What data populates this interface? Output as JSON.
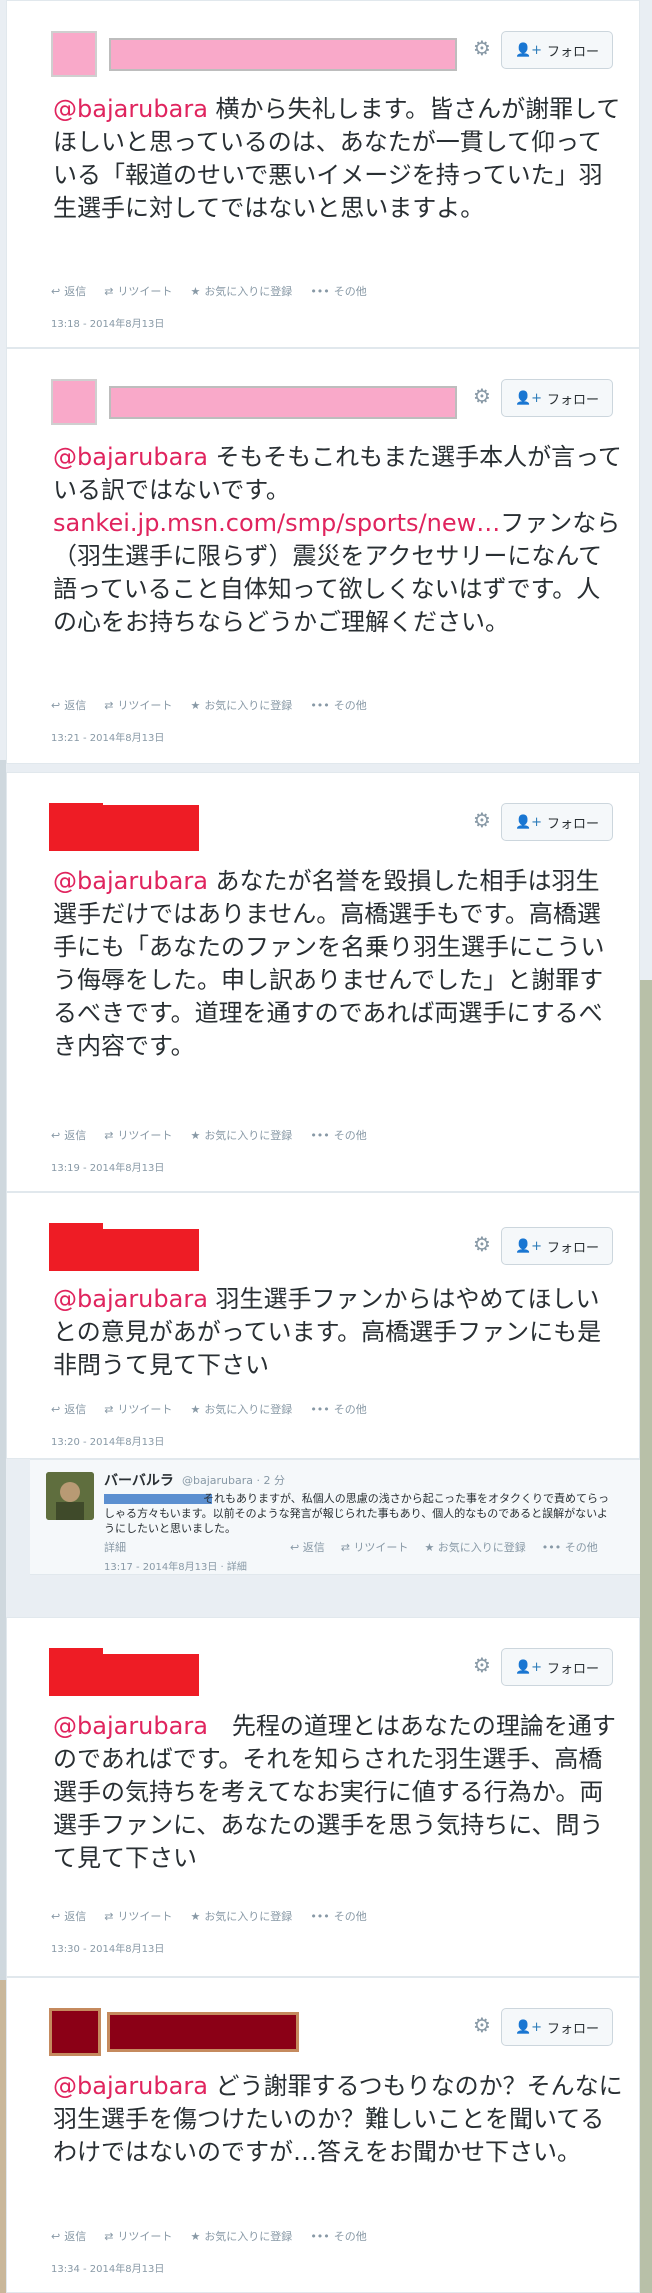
{
  "common": {
    "follow_label": "フォロー",
    "reply_label": "返信",
    "retweet_label": "リツイート",
    "favorite_label": "お気に入りに登録",
    "more_label": "その他"
  },
  "colors": {
    "pink": "#f9a9c9",
    "red": "#ee1c25",
    "darkred": "#8b0016",
    "accent": "#e0245e"
  },
  "tweets": [
    {
      "mention": "@bajarubara",
      "text": " 横から失礼します。皆さんが謝罪してほしいと思っているのは、あなたが一貫して仰っている「報道のせいで悪いイメージを持っていた」羽生選手に対してではないと思いますよ。",
      "timestamp": "13:18 - 2014年8月13日"
    },
    {
      "mention": "@bajarubara",
      "text": " そもそもこれもまた選手本人が言っている訳ではないです。",
      "link": "sankei.jp.msn.com/smp/sports/new…",
      "text2": "ファンなら（羽生選手に限らず）震災をアクセサリーになんて語っていること自体知って欲しくないはずです。人の心をお持ちならどうかご理解ください。",
      "timestamp": "13:21 - 2014年8月13日"
    },
    {
      "mention": "@bajarubara",
      "text": " あなたが名誉を毀損した相手は羽生選手だけではありません。高橋選手もです。高橋選手にも「あなたのファンを名乗り羽生選手にこういう侮辱をした。申し訳ありませんでした」と謝罪するべきです。道理を通すのであれば両選手にするべき内容です。",
      "timestamp": "13:19 - 2014年8月13日"
    },
    {
      "mention": "@bajarubara",
      "text": " 羽生選手ファンからはやめてほしいとの意見があがっています。高橋選手ファンにも是非問うて見て下さい",
      "timestamp": "13:20 - 2014年8月13日"
    },
    {
      "mention": "@bajarubara",
      "text": "　先程の道理とはあなたの理論を通すのであればです。それを知らされた羽生選手、高橋選手の気持ちを考えてなお実行に値する行為か。両選手ファンに、あなたの選手を思う気持ちに、問うて見て下さい",
      "timestamp": "13:30 - 2014年8月13日"
    },
    {
      "mention": "@bajarubara",
      "text": " どう謝罪するつもりなのか？そんなに羽生選手を傷つけたいのか？難しいことを聞いてるわけではないのですが…答えをお聞かせ下さい。",
      "timestamp": "13:34 - 2014年8月13日"
    }
  ],
  "reply_tweet": {
    "name": "バーバルラ",
    "handle": "@bajarubara · 2 分",
    "text": "　　　　　　　　　それもありますが、私個人の思慮の浅さから起こった事をオタクくりで責めてらっしゃる方々もいます。以前そのような発言が報じられた事もあり、個人的なものであると誤解がないようにしたいと思いました。",
    "detail_label": "詳細",
    "timestamp": "13:17 - 2014年8月13日 · 詳細"
  }
}
